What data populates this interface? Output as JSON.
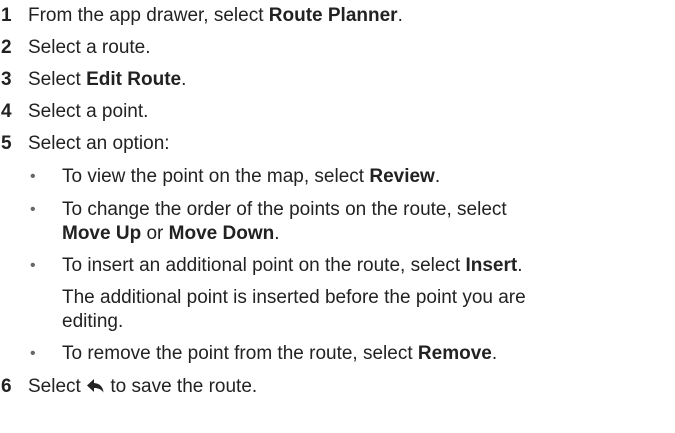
{
  "steps": [
    {
      "num": "1",
      "before": "From the app drawer, select ",
      "bold": "Route Planner",
      "after": "."
    },
    {
      "num": "2",
      "text": "Select a route."
    },
    {
      "num": "3",
      "before": "Select ",
      "bold": "Edit Route",
      "after": "."
    },
    {
      "num": "4",
      "text": "Select a point."
    },
    {
      "num": "5",
      "text": "Select an option:"
    },
    {
      "num": "6",
      "before": "Select ",
      "icon": "back-arrow-icon",
      "after": " to save the route."
    }
  ],
  "options": [
    {
      "before": "To view the point on the map, select ",
      "bold": "Review",
      "after": "."
    },
    {
      "line1": "To change the order of the points on the route, select",
      "bold1": "Move Up",
      "mid": " or ",
      "bold2": "Move Down",
      "after": "."
    },
    {
      "before": "To insert an additional point on the route, select ",
      "bold": "Insert",
      "after": "."
    },
    {
      "before": "To remove the point from the route, select ",
      "bold": "Remove",
      "after": "."
    }
  ],
  "insert_note": {
    "line1": "The additional point is inserted before the point you are",
    "line2": "editing."
  },
  "bullet_char": "•",
  "colors": {
    "text": "#222222",
    "bullet": "#666666"
  }
}
